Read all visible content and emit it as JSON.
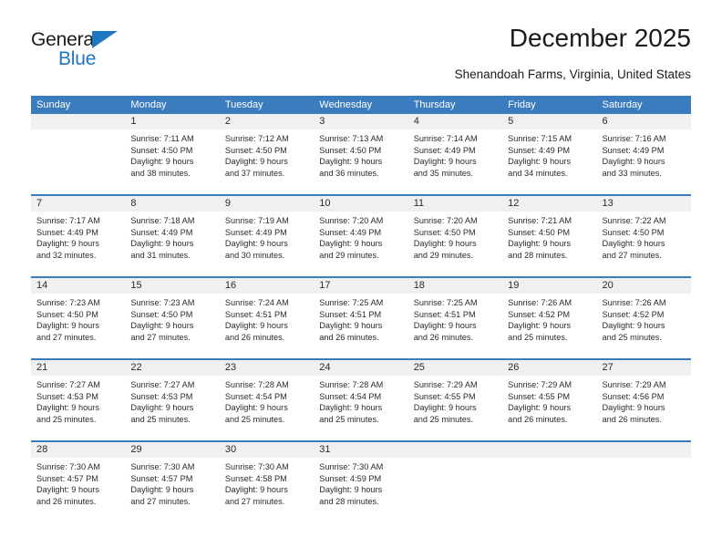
{
  "brand": {
    "name_top": "General",
    "name_bottom": "Blue",
    "accent_color": "#1f77c2"
  },
  "header": {
    "title": "December 2025",
    "subtitle": "Shenandoah Farms, Virginia, United States"
  },
  "calendar": {
    "header_bg": "#3a7cbe",
    "daynum_bg": "#f0f0f0",
    "weekday_headers": [
      "Sunday",
      "Monday",
      "Tuesday",
      "Wednesday",
      "Thursday",
      "Friday",
      "Saturday"
    ],
    "weeks": [
      [
        {
          "day": "",
          "lines": []
        },
        {
          "day": "1",
          "lines": [
            "Sunrise: 7:11 AM",
            "Sunset: 4:50 PM",
            "Daylight: 9 hours",
            "and 38 minutes."
          ]
        },
        {
          "day": "2",
          "lines": [
            "Sunrise: 7:12 AM",
            "Sunset: 4:50 PM",
            "Daylight: 9 hours",
            "and 37 minutes."
          ]
        },
        {
          "day": "3",
          "lines": [
            "Sunrise: 7:13 AM",
            "Sunset: 4:50 PM",
            "Daylight: 9 hours",
            "and 36 minutes."
          ]
        },
        {
          "day": "4",
          "lines": [
            "Sunrise: 7:14 AM",
            "Sunset: 4:49 PM",
            "Daylight: 9 hours",
            "and 35 minutes."
          ]
        },
        {
          "day": "5",
          "lines": [
            "Sunrise: 7:15 AM",
            "Sunset: 4:49 PM",
            "Daylight: 9 hours",
            "and 34 minutes."
          ]
        },
        {
          "day": "6",
          "lines": [
            "Sunrise: 7:16 AM",
            "Sunset: 4:49 PM",
            "Daylight: 9 hours",
            "and 33 minutes."
          ]
        }
      ],
      [
        {
          "day": "7",
          "lines": [
            "Sunrise: 7:17 AM",
            "Sunset: 4:49 PM",
            "Daylight: 9 hours",
            "and 32 minutes."
          ]
        },
        {
          "day": "8",
          "lines": [
            "Sunrise: 7:18 AM",
            "Sunset: 4:49 PM",
            "Daylight: 9 hours",
            "and 31 minutes."
          ]
        },
        {
          "day": "9",
          "lines": [
            "Sunrise: 7:19 AM",
            "Sunset: 4:49 PM",
            "Daylight: 9 hours",
            "and 30 minutes."
          ]
        },
        {
          "day": "10",
          "lines": [
            "Sunrise: 7:20 AM",
            "Sunset: 4:49 PM",
            "Daylight: 9 hours",
            "and 29 minutes."
          ]
        },
        {
          "day": "11",
          "lines": [
            "Sunrise: 7:20 AM",
            "Sunset: 4:50 PM",
            "Daylight: 9 hours",
            "and 29 minutes."
          ]
        },
        {
          "day": "12",
          "lines": [
            "Sunrise: 7:21 AM",
            "Sunset: 4:50 PM",
            "Daylight: 9 hours",
            "and 28 minutes."
          ]
        },
        {
          "day": "13",
          "lines": [
            "Sunrise: 7:22 AM",
            "Sunset: 4:50 PM",
            "Daylight: 9 hours",
            "and 27 minutes."
          ]
        }
      ],
      [
        {
          "day": "14",
          "lines": [
            "Sunrise: 7:23 AM",
            "Sunset: 4:50 PM",
            "Daylight: 9 hours",
            "and 27 minutes."
          ]
        },
        {
          "day": "15",
          "lines": [
            "Sunrise: 7:23 AM",
            "Sunset: 4:50 PM",
            "Daylight: 9 hours",
            "and 27 minutes."
          ]
        },
        {
          "day": "16",
          "lines": [
            "Sunrise: 7:24 AM",
            "Sunset: 4:51 PM",
            "Daylight: 9 hours",
            "and 26 minutes."
          ]
        },
        {
          "day": "17",
          "lines": [
            "Sunrise: 7:25 AM",
            "Sunset: 4:51 PM",
            "Daylight: 9 hours",
            "and 26 minutes."
          ]
        },
        {
          "day": "18",
          "lines": [
            "Sunrise: 7:25 AM",
            "Sunset: 4:51 PM",
            "Daylight: 9 hours",
            "and 26 minutes."
          ]
        },
        {
          "day": "19",
          "lines": [
            "Sunrise: 7:26 AM",
            "Sunset: 4:52 PM",
            "Daylight: 9 hours",
            "and 25 minutes."
          ]
        },
        {
          "day": "20",
          "lines": [
            "Sunrise: 7:26 AM",
            "Sunset: 4:52 PM",
            "Daylight: 9 hours",
            "and 25 minutes."
          ]
        }
      ],
      [
        {
          "day": "21",
          "lines": [
            "Sunrise: 7:27 AM",
            "Sunset: 4:53 PM",
            "Daylight: 9 hours",
            "and 25 minutes."
          ]
        },
        {
          "day": "22",
          "lines": [
            "Sunrise: 7:27 AM",
            "Sunset: 4:53 PM",
            "Daylight: 9 hours",
            "and 25 minutes."
          ]
        },
        {
          "day": "23",
          "lines": [
            "Sunrise: 7:28 AM",
            "Sunset: 4:54 PM",
            "Daylight: 9 hours",
            "and 25 minutes."
          ]
        },
        {
          "day": "24",
          "lines": [
            "Sunrise: 7:28 AM",
            "Sunset: 4:54 PM",
            "Daylight: 9 hours",
            "and 25 minutes."
          ]
        },
        {
          "day": "25",
          "lines": [
            "Sunrise: 7:29 AM",
            "Sunset: 4:55 PM",
            "Daylight: 9 hours",
            "and 25 minutes."
          ]
        },
        {
          "day": "26",
          "lines": [
            "Sunrise: 7:29 AM",
            "Sunset: 4:55 PM",
            "Daylight: 9 hours",
            "and 26 minutes."
          ]
        },
        {
          "day": "27",
          "lines": [
            "Sunrise: 7:29 AM",
            "Sunset: 4:56 PM",
            "Daylight: 9 hours",
            "and 26 minutes."
          ]
        }
      ],
      [
        {
          "day": "28",
          "lines": [
            "Sunrise: 7:30 AM",
            "Sunset: 4:57 PM",
            "Daylight: 9 hours",
            "and 26 minutes."
          ]
        },
        {
          "day": "29",
          "lines": [
            "Sunrise: 7:30 AM",
            "Sunset: 4:57 PM",
            "Daylight: 9 hours",
            "and 27 minutes."
          ]
        },
        {
          "day": "30",
          "lines": [
            "Sunrise: 7:30 AM",
            "Sunset: 4:58 PM",
            "Daylight: 9 hours",
            "and 27 minutes."
          ]
        },
        {
          "day": "31",
          "lines": [
            "Sunrise: 7:30 AM",
            "Sunset: 4:59 PM",
            "Daylight: 9 hours",
            "and 28 minutes."
          ]
        },
        {
          "day": "",
          "lines": []
        },
        {
          "day": "",
          "lines": []
        },
        {
          "day": "",
          "lines": []
        }
      ]
    ]
  }
}
